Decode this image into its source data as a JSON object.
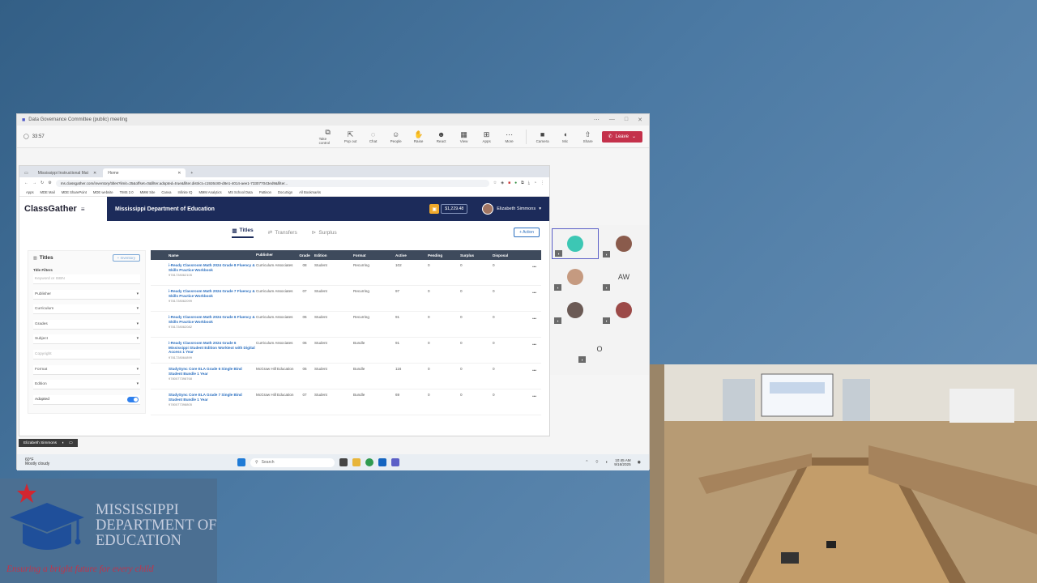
{
  "teams": {
    "title": "Data Governance Committee (public) meeting",
    "timer": "33:57",
    "toolbar": [
      {
        "icon": "take-control-icon",
        "label": "Take control",
        "glyph": "⧉"
      },
      {
        "icon": "pop-out-icon",
        "label": "Pop out",
        "glyph": "⇱"
      },
      {
        "icon": "chat-icon",
        "label": "Chat",
        "glyph": "◌"
      },
      {
        "icon": "people-icon",
        "label": "People",
        "glyph": "☺"
      },
      {
        "icon": "raise-hand-icon",
        "label": "Raise",
        "glyph": "✋"
      },
      {
        "icon": "react-icon",
        "label": "React",
        "glyph": "☻"
      },
      {
        "icon": "view-icon",
        "label": "View",
        "glyph": "▦"
      },
      {
        "icon": "apps-icon",
        "label": "Apps",
        "glyph": "⊞"
      },
      {
        "icon": "more-icon",
        "label": "More",
        "glyph": "⋯"
      },
      {
        "icon": "camera-icon",
        "label": "Camera",
        "glyph": "■"
      },
      {
        "icon": "mic-icon",
        "label": "Mic",
        "glyph": "◖"
      },
      {
        "icon": "share-icon",
        "label": "Share",
        "glyph": "⇧"
      }
    ],
    "leave_label": "Leave",
    "presenter": "Elizabeth Simmons",
    "participants": [
      {
        "type": "icon",
        "color": "#3cc7b4"
      },
      {
        "type": "photo",
        "color": "#8a5b4c"
      },
      {
        "type": "photo",
        "color": "#c59a80"
      },
      {
        "type": "initials",
        "text": "AW"
      },
      {
        "type": "photo",
        "color": "#6b5a55"
      },
      {
        "type": "photo",
        "color": "#9c4a48"
      },
      {
        "type": "initials",
        "text": "O"
      }
    ]
  },
  "browser": {
    "tabs": [
      {
        "label": "Mississippi Instructional Mat"
      },
      {
        "label": "Home"
      }
    ],
    "url": "ms.classgather.com/inventory/titles?limit=25&offset=0&filter.adopted=true&filter.district=c1926c80-d8e1-4014-aee1-733077043ed9&filter...",
    "bookmarks": [
      "Apps",
      "MDE Mail",
      "MDE SharePoint",
      "MDE website",
      "TIMS 2.0",
      "MMM Site",
      "Canva",
      "Infinite IQ",
      "MMM Analytics",
      "MS School Data",
      "Pattison",
      "DocuSign",
      "All Bookmarks"
    ]
  },
  "app": {
    "logo": "ClassGather",
    "org": "Mississippi Department of Education",
    "balance": "$1,229.48",
    "user": "Elizabeth Simmons",
    "subtabs": [
      "Titles",
      "Transfers",
      "Surplus"
    ],
    "action_button": "+ Action",
    "sidebar": {
      "title": "Titles",
      "inventory_button": "+ Inventory",
      "section_label": "Title Filters",
      "filters": [
        {
          "label": "Keyword or ISBN",
          "placeholder": true,
          "dropdown": false
        },
        {
          "label": "Publisher",
          "placeholder": false,
          "dropdown": true
        },
        {
          "label": "Curriculum",
          "placeholder": false,
          "dropdown": true
        },
        {
          "label": "Grades",
          "placeholder": false,
          "dropdown": true
        },
        {
          "label": "Subject",
          "placeholder": false,
          "dropdown": true
        },
        {
          "label": "Copyright",
          "placeholder": true,
          "dropdown": false
        },
        {
          "label": "Format",
          "placeholder": false,
          "dropdown": true
        },
        {
          "label": "Edition",
          "placeholder": false,
          "dropdown": true
        }
      ],
      "adopted_label": "Adopted",
      "adopted_on": true
    },
    "table": {
      "columns": [
        "Name",
        "Publisher",
        "Grade",
        "Edition",
        "Format",
        "Active",
        "Pending",
        "Surplus",
        "Disposal"
      ],
      "rows": [
        {
          "name": "i-Ready Classroom Math 2024 Grade 8 Fluency & Skills Practice Workbook",
          "isbn": "9781728062105",
          "publisher": "Curriculum Associates",
          "grade": "08",
          "edition": "Student",
          "format": "Recurring",
          "active": "102",
          "pending": "0",
          "surplus": "0",
          "disposal": "0"
        },
        {
          "name": "i-Ready Classroom Math 2024 Grade 7 Fluency & Skills Practice Workbook",
          "isbn": "9781728062099",
          "publisher": "Curriculum Associates",
          "grade": "07",
          "edition": "Student",
          "format": "Recurring",
          "active": "97",
          "pending": "0",
          "surplus": "0",
          "disposal": "0"
        },
        {
          "name": "i-Ready Classroom Math 2024 Grade 6 Fluency & Skills Practice Workbook",
          "isbn": "9781728062082",
          "publisher": "Curriculum Associates",
          "grade": "06",
          "edition": "Student",
          "format": "Recurring",
          "active": "91",
          "pending": "0",
          "surplus": "0",
          "disposal": "0"
        },
        {
          "name": "i-Ready Classroom Math 2024 Grade 6 Mississippi Student Edition Worktext with Digital Access 1 Year",
          "isbn": "9781728064899",
          "publisher": "Curriculum Associates",
          "grade": "06",
          "edition": "Student",
          "format": "Bundle",
          "active": "91",
          "pending": "0",
          "surplus": "0",
          "disposal": "0"
        },
        {
          "name": "StudySync Core ELA Grade 6 Single Bind Student Bundle 1 Year",
          "isbn": "9780077398768",
          "publisher": "McGraw Hill Education",
          "grade": "06",
          "edition": "Student",
          "format": "Bundle",
          "active": "116",
          "pending": "0",
          "surplus": "0",
          "disposal": "0"
        },
        {
          "name": "StudySync Core ELA Grade 7 Single Bind Student Bundle 1 Year",
          "isbn": "9780077398805",
          "publisher": "McGraw Hill Education",
          "grade": "07",
          "edition": "Student",
          "format": "Bundle",
          "active": "69",
          "pending": "0",
          "surplus": "0",
          "disposal": "0"
        }
      ]
    }
  },
  "taskbar": {
    "weather_temp": "60°F",
    "weather_desc": "Mostly cloudy",
    "search_placeholder": "Search",
    "time": "10:45 AM",
    "date": "9/16/2025"
  },
  "logo": {
    "name_lines": [
      "MISSISSIPPI",
      "DEPARTMENT OF",
      "EDUCATION"
    ],
    "tagline": "Ensuring a bright future for every child"
  },
  "colors": {
    "navy": "#1c2b5a",
    "link": "#2b6fbf",
    "leave": "#c4314b",
    "star": "#d22630",
    "logo_blue": "#1f4f9a"
  }
}
